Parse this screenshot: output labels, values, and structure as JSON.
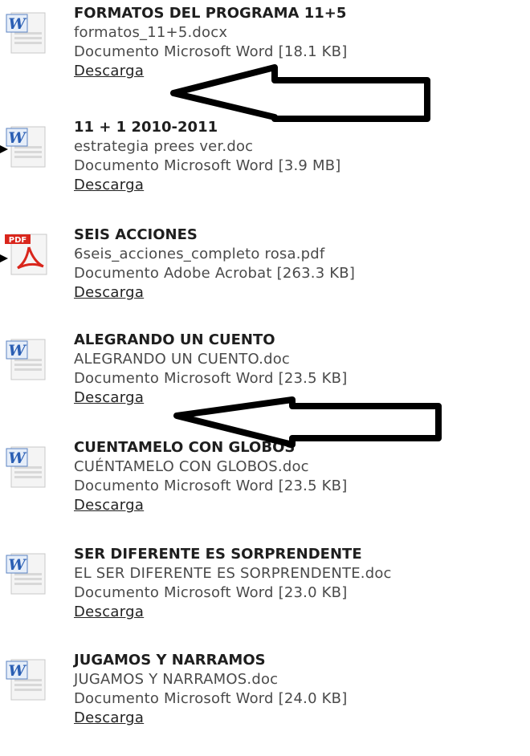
{
  "downloads": [
    {
      "title": "FORMATOS DEL PROGRAMA 11+5",
      "filename": "formatos_11+5.docx",
      "type": "Documento Microsoft Word",
      "size": "[18.1 KB]",
      "link": "Descarga",
      "icon": "word-doc-icon"
    },
    {
      "title": "11 + 1 2010-2011",
      "filename": "estrategia prees ver.doc",
      "type": "Documento Microsoft Word",
      "size": "[3.9 MB]",
      "link": "Descarga",
      "icon": "word-doc-icon"
    },
    {
      "title": "SEIS ACCIONES",
      "filename": "6seis_acciones_completo rosa.pdf",
      "type": "Documento Adobe Acrobat",
      "size": "[263.3 KB]",
      "link": "Descarga",
      "icon": "pdf-doc-icon"
    },
    {
      "title": "ALEGRANDO UN CUENTO",
      "filename": "ALEGRANDO UN CUENTO.doc",
      "type": "Documento Microsoft Word",
      "size": "[23.5 KB]",
      "link": "Descarga",
      "icon": "word-doc-icon"
    },
    {
      "title": "CUENTAMELO CON GLOBOS",
      "filename": "CUÉNTAMELO CON GLOBOS.doc",
      "type": "Documento Microsoft Word",
      "size": "[23.5 KB]",
      "link": "Descarga",
      "icon": "word-doc-icon"
    },
    {
      "title": "SER DIFERENTE ES SORPRENDENTE",
      "filename": "EL SER DIFERENTE ES SORPRENDENTE.doc",
      "type": "Documento Microsoft Word",
      "size": "[23.0 KB]",
      "link": "Descarga",
      "icon": "word-doc-icon"
    },
    {
      "title": "JUGAMOS Y NARRAMOS",
      "filename": "JUGAMOS Y NARRAMOS.doc",
      "type": "Documento Microsoft Word",
      "size": "[24.0 KB]",
      "link": "Descarga",
      "icon": "word-doc-icon"
    }
  ],
  "pdf_badge": "PDF",
  "word_badge": "W",
  "colors": {
    "pdf_red": "#d9261c",
    "word_blue": "#2b5fb4",
    "arrow": "#000000"
  }
}
